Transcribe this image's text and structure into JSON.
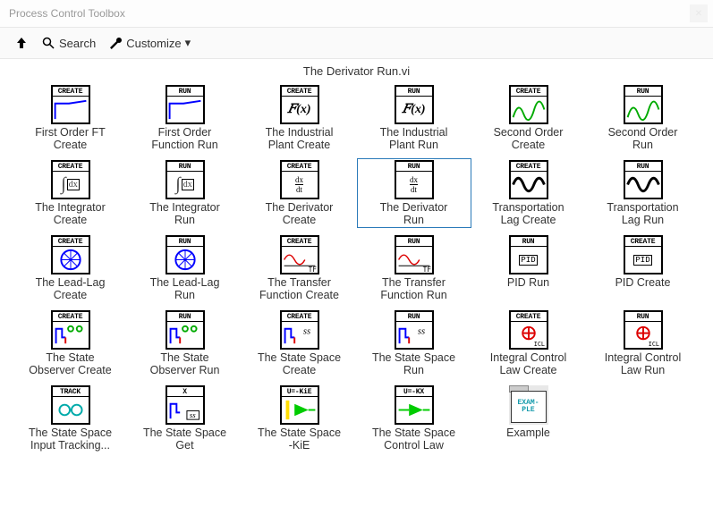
{
  "window": {
    "title": "Process Control Toolbox",
    "close_glyph": "✕"
  },
  "toolbar": {
    "search_label": "Search",
    "customize_label": "Customize"
  },
  "palette": {
    "title": "The Derivator Run.vi"
  },
  "banners": {
    "create": "CREATE",
    "run": "RUN",
    "track": "TRACK",
    "x": "X"
  },
  "items": [
    {
      "id": "first-order-ft-create",
      "banner": "CREATE",
      "label": "First Order FT\nCreate",
      "glyph": "step-blue"
    },
    {
      "id": "first-order-function-run",
      "banner": "RUN",
      "label": "First Order\nFunction Run",
      "glyph": "step-blue"
    },
    {
      "id": "industrial-plant-create",
      "banner": "CREATE",
      "label": "The Industrial\nPlant Create",
      "glyph": "fx"
    },
    {
      "id": "industrial-plant-run",
      "banner": "RUN",
      "label": "The Industrial\nPlant Run",
      "glyph": "fx"
    },
    {
      "id": "second-order-create",
      "banner": "CREATE",
      "label": "Second Order\nCreate",
      "glyph": "wave-green"
    },
    {
      "id": "second-order-run",
      "banner": "RUN",
      "label": "Second Order\nRun",
      "glyph": "wave-green"
    },
    {
      "id": "integrator-create",
      "banner": "CREATE",
      "label": "The Integrator\nCreate",
      "glyph": "integral"
    },
    {
      "id": "integrator-run",
      "banner": "RUN",
      "label": "The Integrator\nRun",
      "glyph": "integral"
    },
    {
      "id": "derivator-create",
      "banner": "CREATE",
      "label": "The Derivator\nCreate",
      "glyph": "dxdt"
    },
    {
      "id": "derivator-run",
      "banner": "RUN",
      "label": "The Derivator\nRun",
      "glyph": "dxdt",
      "selected": true
    },
    {
      "id": "transportation-lag-create",
      "banner": "CREATE",
      "label": "Transportation\nLag Create",
      "glyph": "sine-black"
    },
    {
      "id": "transportation-lag-run",
      "banner": "RUN",
      "label": "Transportation\nLag Run",
      "glyph": "sine-black"
    },
    {
      "id": "lead-lag-create",
      "banner": "CREATE",
      "label": "The Lead-Lag\nCreate",
      "glyph": "compass"
    },
    {
      "id": "lead-lag-run",
      "banner": "RUN",
      "label": "The Lead-Lag\nRun",
      "glyph": "compass"
    },
    {
      "id": "transfer-function-create",
      "banner": "CREATE",
      "label": "The Transfer\nFunction Create",
      "glyph": "tf"
    },
    {
      "id": "transfer-function-run",
      "banner": "RUN",
      "label": "The Transfer\nFunction Run",
      "glyph": "tf"
    },
    {
      "id": "pid-run",
      "banner": "RUN",
      "label": "PID Run",
      "glyph": "pid"
    },
    {
      "id": "pid-create",
      "banner": "CREATE",
      "label": "PID Create",
      "glyph": "pid"
    },
    {
      "id": "state-observer-create",
      "banner": "CREATE",
      "label": "The State\nObserver Create",
      "glyph": "observer"
    },
    {
      "id": "state-observer-run",
      "banner": "RUN",
      "label": "The State\nObserver Run",
      "glyph": "observer"
    },
    {
      "id": "state-space-create",
      "banner": "CREATE",
      "label": "The State Space\nCreate",
      "glyph": "ss"
    },
    {
      "id": "state-space-run",
      "banner": "RUN",
      "label": "The State Space\nRun",
      "glyph": "ss"
    },
    {
      "id": "integral-control-law-create",
      "banner": "CREATE",
      "label": "Integral Control\nLaw Create",
      "glyph": "icl"
    },
    {
      "id": "integral-control-law-run",
      "banner": "RUN",
      "label": "Integral Control\nLaw Run",
      "glyph": "icl"
    },
    {
      "id": "state-space-input-tracking",
      "banner": "TRACK",
      "label": "The State Space\nInput Tracking...",
      "glyph": "glasses"
    },
    {
      "id": "state-space-get",
      "banner": "X",
      "label": "The State Space\nGet",
      "glyph": "ss-small"
    },
    {
      "id": "state-space-kie",
      "banner": "",
      "label": "The State Space\n-KiE",
      "glyph": "ukie",
      "banner_text": "U=-KiE"
    },
    {
      "id": "state-space-control-law",
      "banner": "",
      "label": "The State Space\nControl Law",
      "glyph": "ukx",
      "banner_text": "U=-KX"
    },
    {
      "id": "example",
      "banner": "",
      "label": "Example",
      "glyph": "example",
      "example_text": "EXAM-\nPLE"
    }
  ]
}
